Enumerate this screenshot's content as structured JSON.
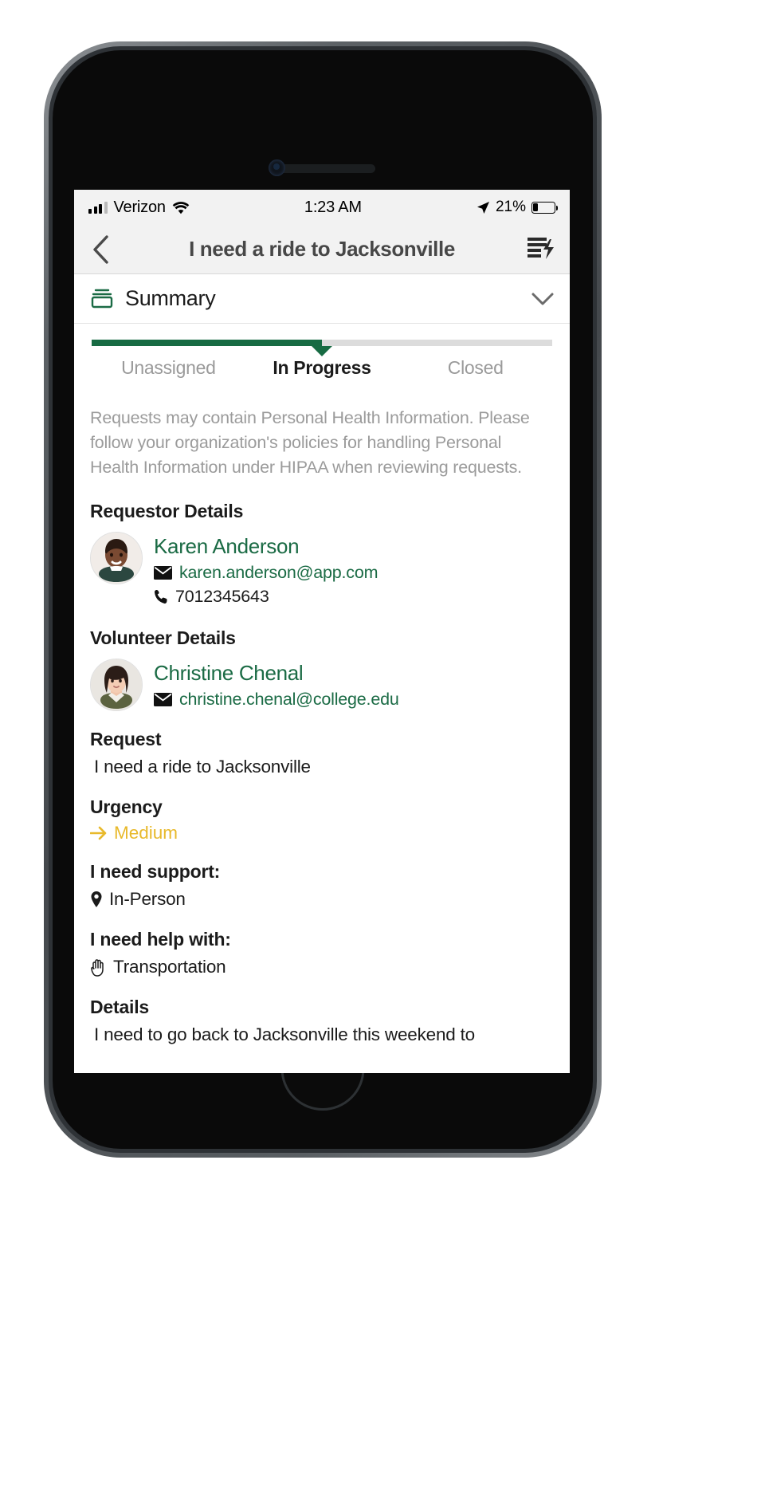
{
  "status_bar": {
    "signal_icon": "cellular-bars-icon",
    "carrier": "Verizon",
    "wifi_icon": "wifi-icon",
    "time": "1:23 AM",
    "location_icon": "location-arrow-icon",
    "battery_percent": "21%",
    "battery_level": 21,
    "battery_icon": "battery-icon"
  },
  "nav": {
    "back_icon": "back-chevron-icon",
    "title": "I need a ride to Jacksonville",
    "action_icon": "request-list-icon"
  },
  "summary": {
    "icon": "inbox-tray-icon",
    "label": "Summary",
    "caret_icon": "chevron-down-icon"
  },
  "stepper": {
    "steps": [
      {
        "label": "Unassigned",
        "state": "complete"
      },
      {
        "label": "In Progress",
        "state": "active"
      },
      {
        "label": "Closed",
        "state": "pending"
      }
    ],
    "active_index": 1,
    "fill_percent": 50,
    "fill_color": "#176b43",
    "track_color": "#dcdcdc"
  },
  "disclaimer": "Requests may contain Personal Health Information. Please follow your organization's policies for handling Personal Health Information under HIPAA when reviewing requests.",
  "requestor": {
    "section_title": "Requestor Details",
    "avatar_name": "requestor-avatar",
    "name": "Karen Anderson",
    "email_icon": "envelope-icon",
    "email": "karen.anderson@app.com",
    "phone_icon": "phone-icon",
    "phone": "7012345643"
  },
  "volunteer": {
    "section_title": "Volunteer Details",
    "avatar_name": "volunteer-avatar",
    "name": "Christine Chenal",
    "email_icon": "envelope-icon",
    "email": "christine.chenal@college.edu"
  },
  "fields": {
    "request_label": "Request",
    "request_value": "I need a ride to Jacksonville",
    "urgency_label": "Urgency",
    "urgency_icon": "arrow-right-icon",
    "urgency_value": "Medium",
    "urgency_color": "#e8b92b",
    "support_label": "I need support:",
    "support_icon": "map-pin-icon",
    "support_value": "In-Person",
    "help_label": "I need help with:",
    "help_icon": "hand-icon",
    "help_value": "Transportation",
    "details_label": "Details",
    "details_value": "I need to go back to Jacksonville this weekend to"
  },
  "theme": {
    "brand_green": "#1b6b45",
    "status_bar_bg": "#f2f2f2",
    "muted_text": "#9b9b9b"
  }
}
